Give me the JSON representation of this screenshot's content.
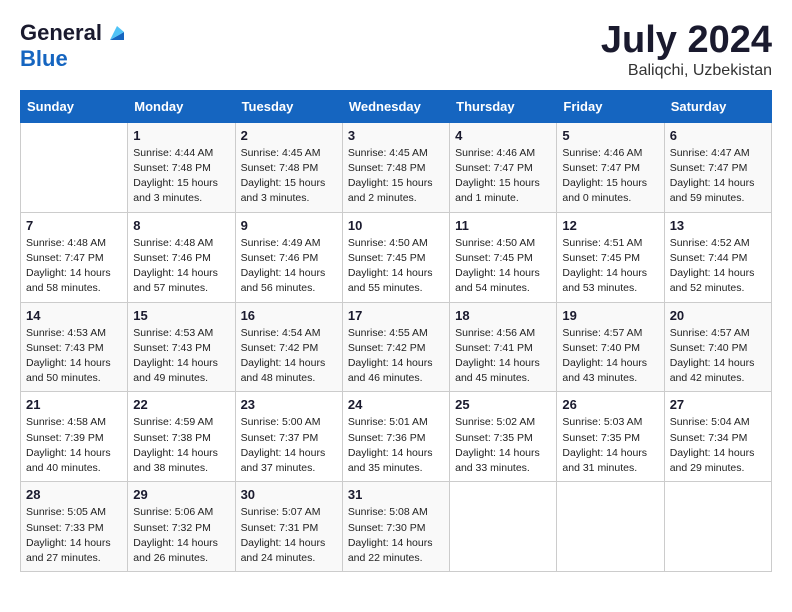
{
  "logo": {
    "general": "General",
    "blue": "Blue"
  },
  "title": "July 2024",
  "location": "Baliqchi, Uzbekistan",
  "days_of_week": [
    "Sunday",
    "Monday",
    "Tuesday",
    "Wednesday",
    "Thursday",
    "Friday",
    "Saturday"
  ],
  "weeks": [
    [
      {
        "num": "",
        "info": ""
      },
      {
        "num": "1",
        "info": "Sunrise: 4:44 AM\nSunset: 7:48 PM\nDaylight: 15 hours\nand 3 minutes."
      },
      {
        "num": "2",
        "info": "Sunrise: 4:45 AM\nSunset: 7:48 PM\nDaylight: 15 hours\nand 3 minutes."
      },
      {
        "num": "3",
        "info": "Sunrise: 4:45 AM\nSunset: 7:48 PM\nDaylight: 15 hours\nand 2 minutes."
      },
      {
        "num": "4",
        "info": "Sunrise: 4:46 AM\nSunset: 7:47 PM\nDaylight: 15 hours\nand 1 minute."
      },
      {
        "num": "5",
        "info": "Sunrise: 4:46 AM\nSunset: 7:47 PM\nDaylight: 15 hours\nand 0 minutes."
      },
      {
        "num": "6",
        "info": "Sunrise: 4:47 AM\nSunset: 7:47 PM\nDaylight: 14 hours\nand 59 minutes."
      }
    ],
    [
      {
        "num": "7",
        "info": "Sunrise: 4:48 AM\nSunset: 7:47 PM\nDaylight: 14 hours\nand 58 minutes."
      },
      {
        "num": "8",
        "info": "Sunrise: 4:48 AM\nSunset: 7:46 PM\nDaylight: 14 hours\nand 57 minutes."
      },
      {
        "num": "9",
        "info": "Sunrise: 4:49 AM\nSunset: 7:46 PM\nDaylight: 14 hours\nand 56 minutes."
      },
      {
        "num": "10",
        "info": "Sunrise: 4:50 AM\nSunset: 7:45 PM\nDaylight: 14 hours\nand 55 minutes."
      },
      {
        "num": "11",
        "info": "Sunrise: 4:50 AM\nSunset: 7:45 PM\nDaylight: 14 hours\nand 54 minutes."
      },
      {
        "num": "12",
        "info": "Sunrise: 4:51 AM\nSunset: 7:45 PM\nDaylight: 14 hours\nand 53 minutes."
      },
      {
        "num": "13",
        "info": "Sunrise: 4:52 AM\nSunset: 7:44 PM\nDaylight: 14 hours\nand 52 minutes."
      }
    ],
    [
      {
        "num": "14",
        "info": "Sunrise: 4:53 AM\nSunset: 7:43 PM\nDaylight: 14 hours\nand 50 minutes."
      },
      {
        "num": "15",
        "info": "Sunrise: 4:53 AM\nSunset: 7:43 PM\nDaylight: 14 hours\nand 49 minutes."
      },
      {
        "num": "16",
        "info": "Sunrise: 4:54 AM\nSunset: 7:42 PM\nDaylight: 14 hours\nand 48 minutes."
      },
      {
        "num": "17",
        "info": "Sunrise: 4:55 AM\nSunset: 7:42 PM\nDaylight: 14 hours\nand 46 minutes."
      },
      {
        "num": "18",
        "info": "Sunrise: 4:56 AM\nSunset: 7:41 PM\nDaylight: 14 hours\nand 45 minutes."
      },
      {
        "num": "19",
        "info": "Sunrise: 4:57 AM\nSunset: 7:40 PM\nDaylight: 14 hours\nand 43 minutes."
      },
      {
        "num": "20",
        "info": "Sunrise: 4:57 AM\nSunset: 7:40 PM\nDaylight: 14 hours\nand 42 minutes."
      }
    ],
    [
      {
        "num": "21",
        "info": "Sunrise: 4:58 AM\nSunset: 7:39 PM\nDaylight: 14 hours\nand 40 minutes."
      },
      {
        "num": "22",
        "info": "Sunrise: 4:59 AM\nSunset: 7:38 PM\nDaylight: 14 hours\nand 38 minutes."
      },
      {
        "num": "23",
        "info": "Sunrise: 5:00 AM\nSunset: 7:37 PM\nDaylight: 14 hours\nand 37 minutes."
      },
      {
        "num": "24",
        "info": "Sunrise: 5:01 AM\nSunset: 7:36 PM\nDaylight: 14 hours\nand 35 minutes."
      },
      {
        "num": "25",
        "info": "Sunrise: 5:02 AM\nSunset: 7:35 PM\nDaylight: 14 hours\nand 33 minutes."
      },
      {
        "num": "26",
        "info": "Sunrise: 5:03 AM\nSunset: 7:35 PM\nDaylight: 14 hours\nand 31 minutes."
      },
      {
        "num": "27",
        "info": "Sunrise: 5:04 AM\nSunset: 7:34 PM\nDaylight: 14 hours\nand 29 minutes."
      }
    ],
    [
      {
        "num": "28",
        "info": "Sunrise: 5:05 AM\nSunset: 7:33 PM\nDaylight: 14 hours\nand 27 minutes."
      },
      {
        "num": "29",
        "info": "Sunrise: 5:06 AM\nSunset: 7:32 PM\nDaylight: 14 hours\nand 26 minutes."
      },
      {
        "num": "30",
        "info": "Sunrise: 5:07 AM\nSunset: 7:31 PM\nDaylight: 14 hours\nand 24 minutes."
      },
      {
        "num": "31",
        "info": "Sunrise: 5:08 AM\nSunset: 7:30 PM\nDaylight: 14 hours\nand 22 minutes."
      },
      {
        "num": "",
        "info": ""
      },
      {
        "num": "",
        "info": ""
      },
      {
        "num": "",
        "info": ""
      }
    ]
  ]
}
